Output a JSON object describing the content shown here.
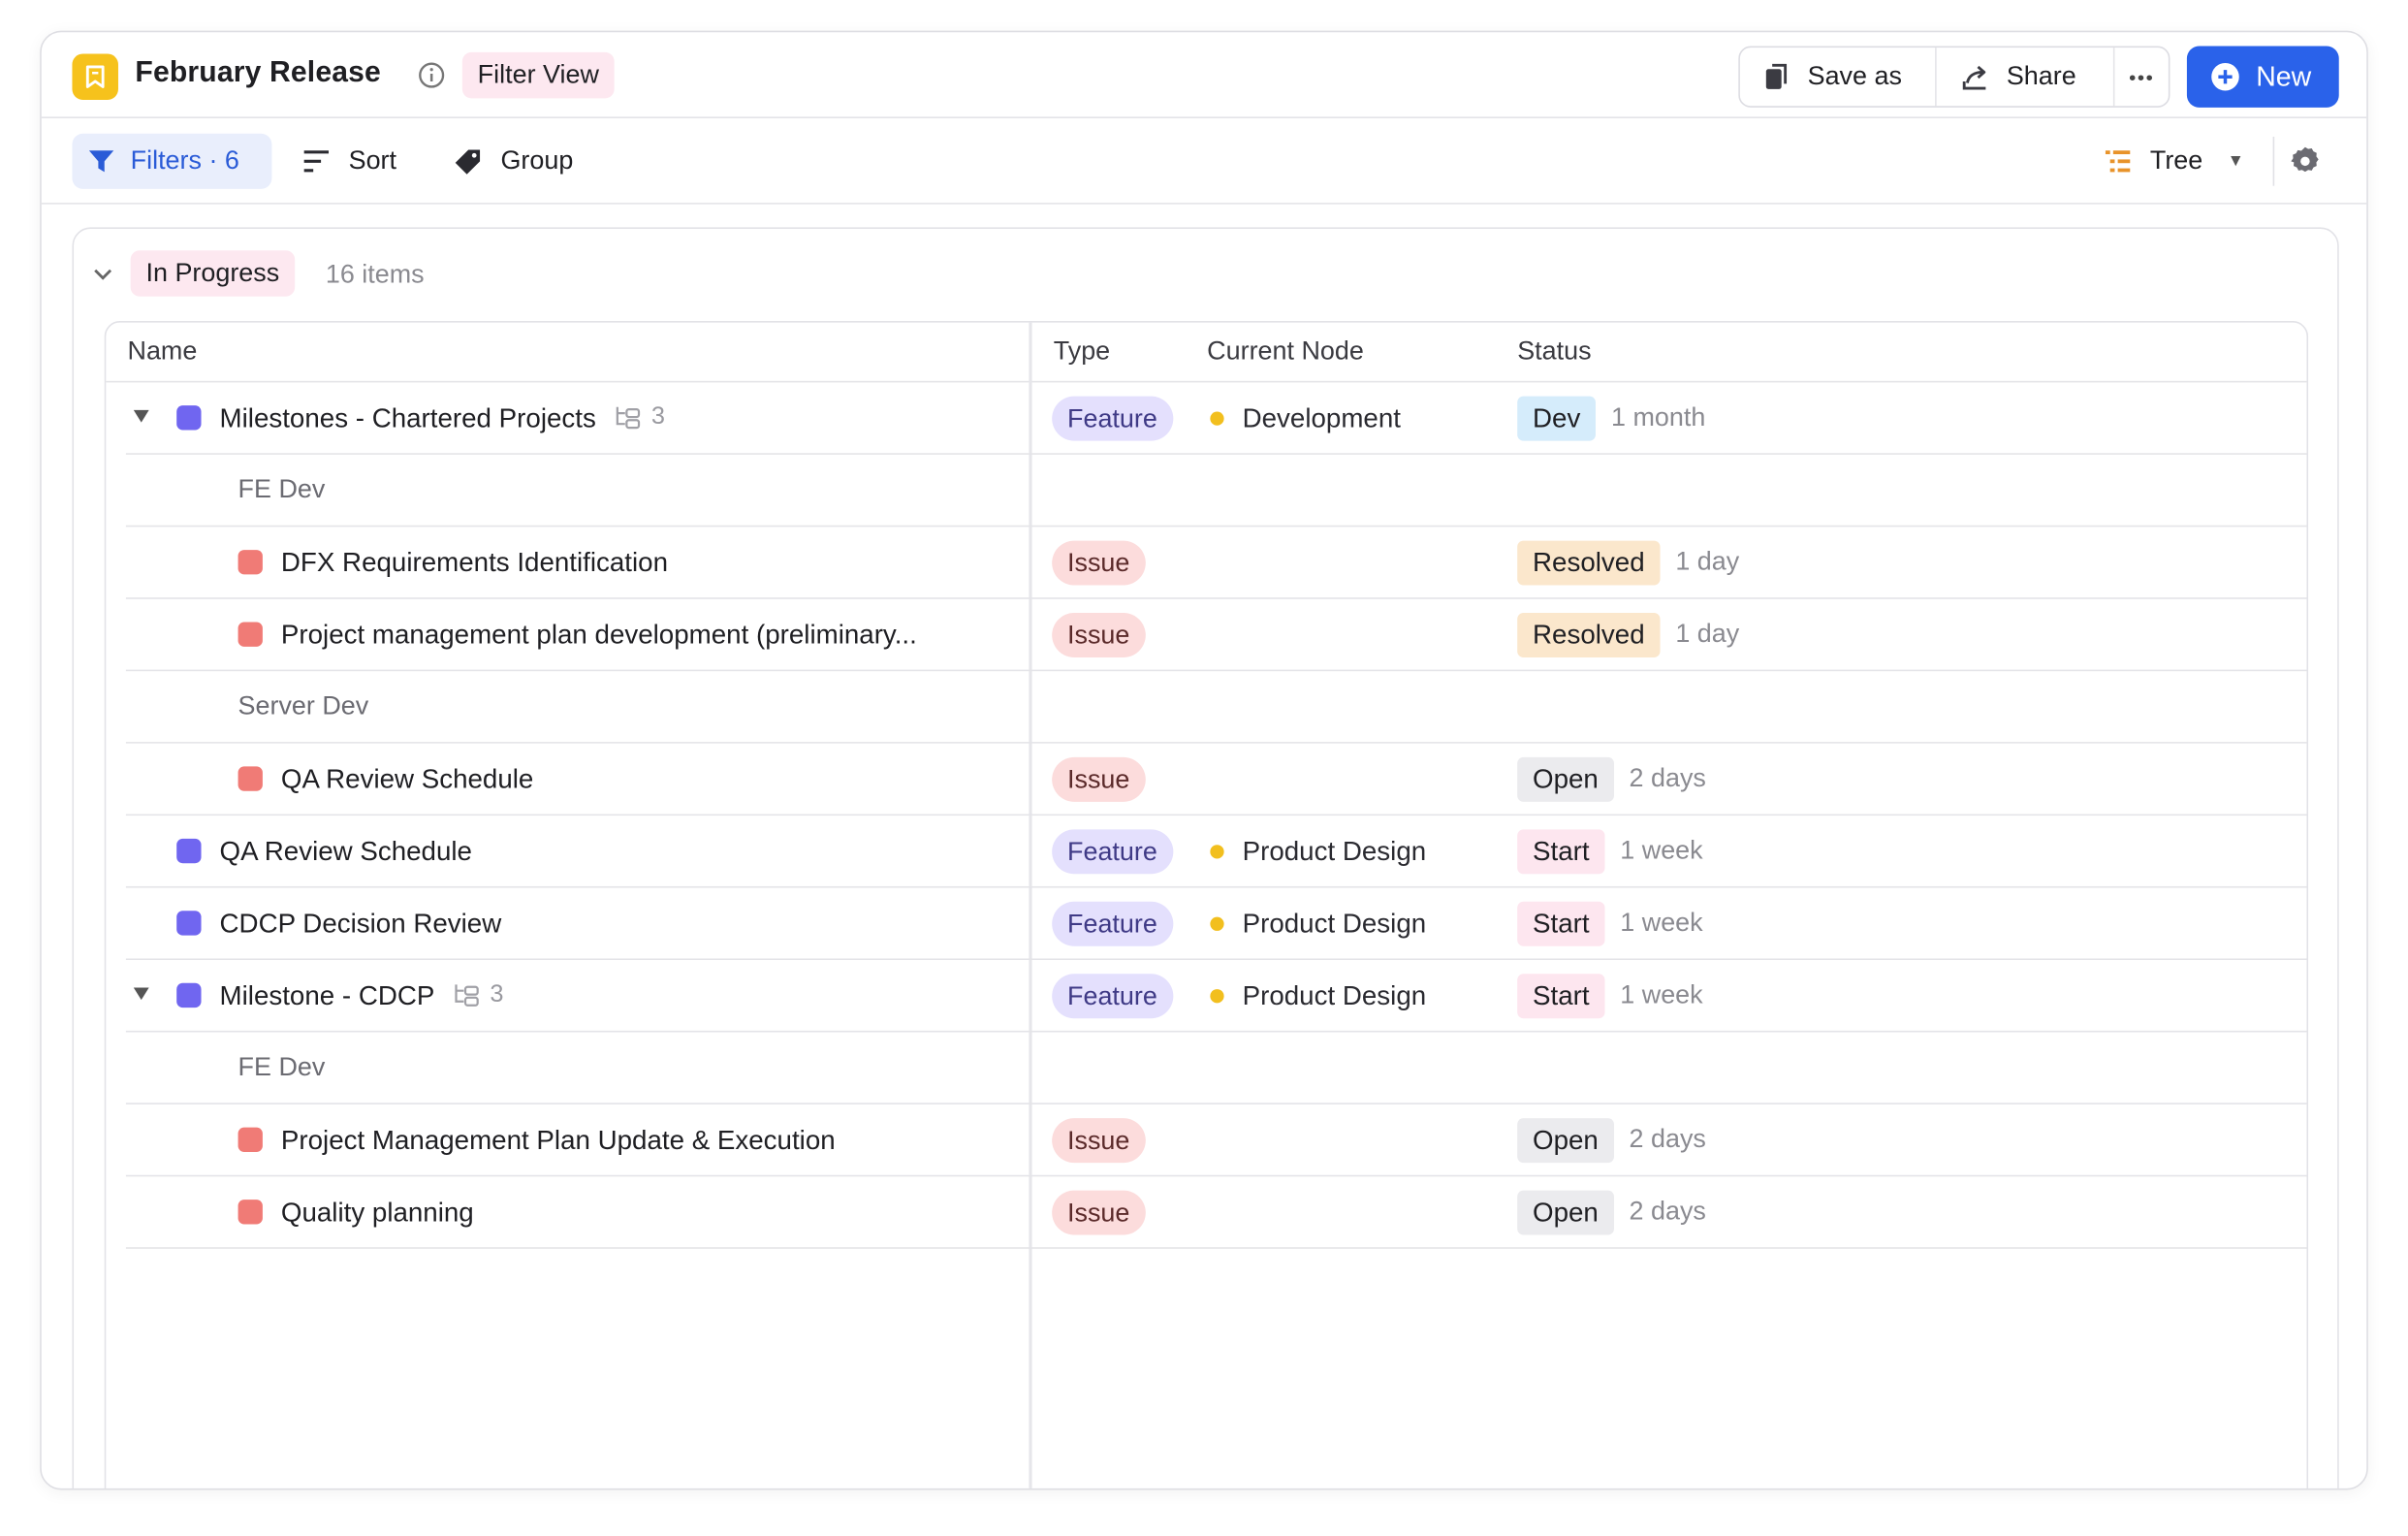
{
  "header": {
    "title": "February Release",
    "view_badge": "Filter View",
    "save_as_label": "Save as",
    "share_label": "Share",
    "new_label": "New",
    "more_label": "•••"
  },
  "toolbar": {
    "filters_label": "Filters · 6",
    "sort_label": "Sort",
    "group_label": "Group",
    "view_mode_label": "Tree"
  },
  "group": {
    "name": "In Progress",
    "count": "16 items"
  },
  "columns": {
    "name": "Name",
    "type": "Type",
    "current_node": "Current Node",
    "status": "Status"
  },
  "colors": {
    "accent": "#2a62ea",
    "feature_square": "#7066f0",
    "issue_square": "#f07b76",
    "node_dot": "#f2bf1e",
    "app_icon": "#f6c21c"
  },
  "rows": [
    {
      "kind": "item",
      "indent": 0,
      "expanded": true,
      "icon": "feature",
      "name": "Milestones - Chartered Projects",
      "subcount": "3",
      "type": "Feature",
      "node": "Development",
      "status": "Dev",
      "status_color": "#d5ecfb",
      "duration": "1 month"
    },
    {
      "kind": "section",
      "label": "FE Dev"
    },
    {
      "kind": "item",
      "indent": 1,
      "icon": "issue",
      "name": "DFX Requirements Identification",
      "type": "Issue",
      "node": "",
      "status": "Resolved",
      "status_color": "#fbe7cc",
      "duration": "1 day"
    },
    {
      "kind": "item",
      "indent": 1,
      "icon": "issue",
      "name": "Project management plan development (preliminary...",
      "type": "Issue",
      "node": "",
      "status": "Resolved",
      "status_color": "#fbe7cc",
      "duration": "1 day"
    },
    {
      "kind": "section",
      "label": "Server Dev"
    },
    {
      "kind": "item",
      "indent": 1,
      "icon": "issue",
      "name": "QA Review Schedule",
      "type": "Issue",
      "node": "",
      "status": "Open",
      "status_color": "#ebebee",
      "duration": "2 days"
    },
    {
      "kind": "item",
      "indent": 0,
      "icon": "feature",
      "name": "QA Review Schedule",
      "type": "Feature",
      "node": "Product Design",
      "status": "Start",
      "status_color": "#fde6ef",
      "duration": "1 week"
    },
    {
      "kind": "item",
      "indent": 0,
      "icon": "feature",
      "name": "CDCP Decision Review",
      "type": "Feature",
      "node": "Product Design",
      "status": "Start",
      "status_color": "#fde6ef",
      "duration": "1 week"
    },
    {
      "kind": "item",
      "indent": 0,
      "expanded": true,
      "icon": "feature",
      "name": "Milestone - CDCP",
      "subcount": "3",
      "type": "Feature",
      "node": "Product Design",
      "status": "Start",
      "status_color": "#fde6ef",
      "duration": "1 week"
    },
    {
      "kind": "section",
      "label": "FE Dev"
    },
    {
      "kind": "item",
      "indent": 1,
      "icon": "issue",
      "name": "Project Management Plan Update & Execution",
      "type": "Issue",
      "node": "",
      "status": "Open",
      "status_color": "#ebebee",
      "duration": "2 days"
    },
    {
      "kind": "item",
      "indent": 1,
      "icon": "issue",
      "name": "Quality planning",
      "type": "Issue",
      "node": "",
      "status": "Open",
      "status_color": "#ebebee",
      "duration": "2 days"
    }
  ]
}
